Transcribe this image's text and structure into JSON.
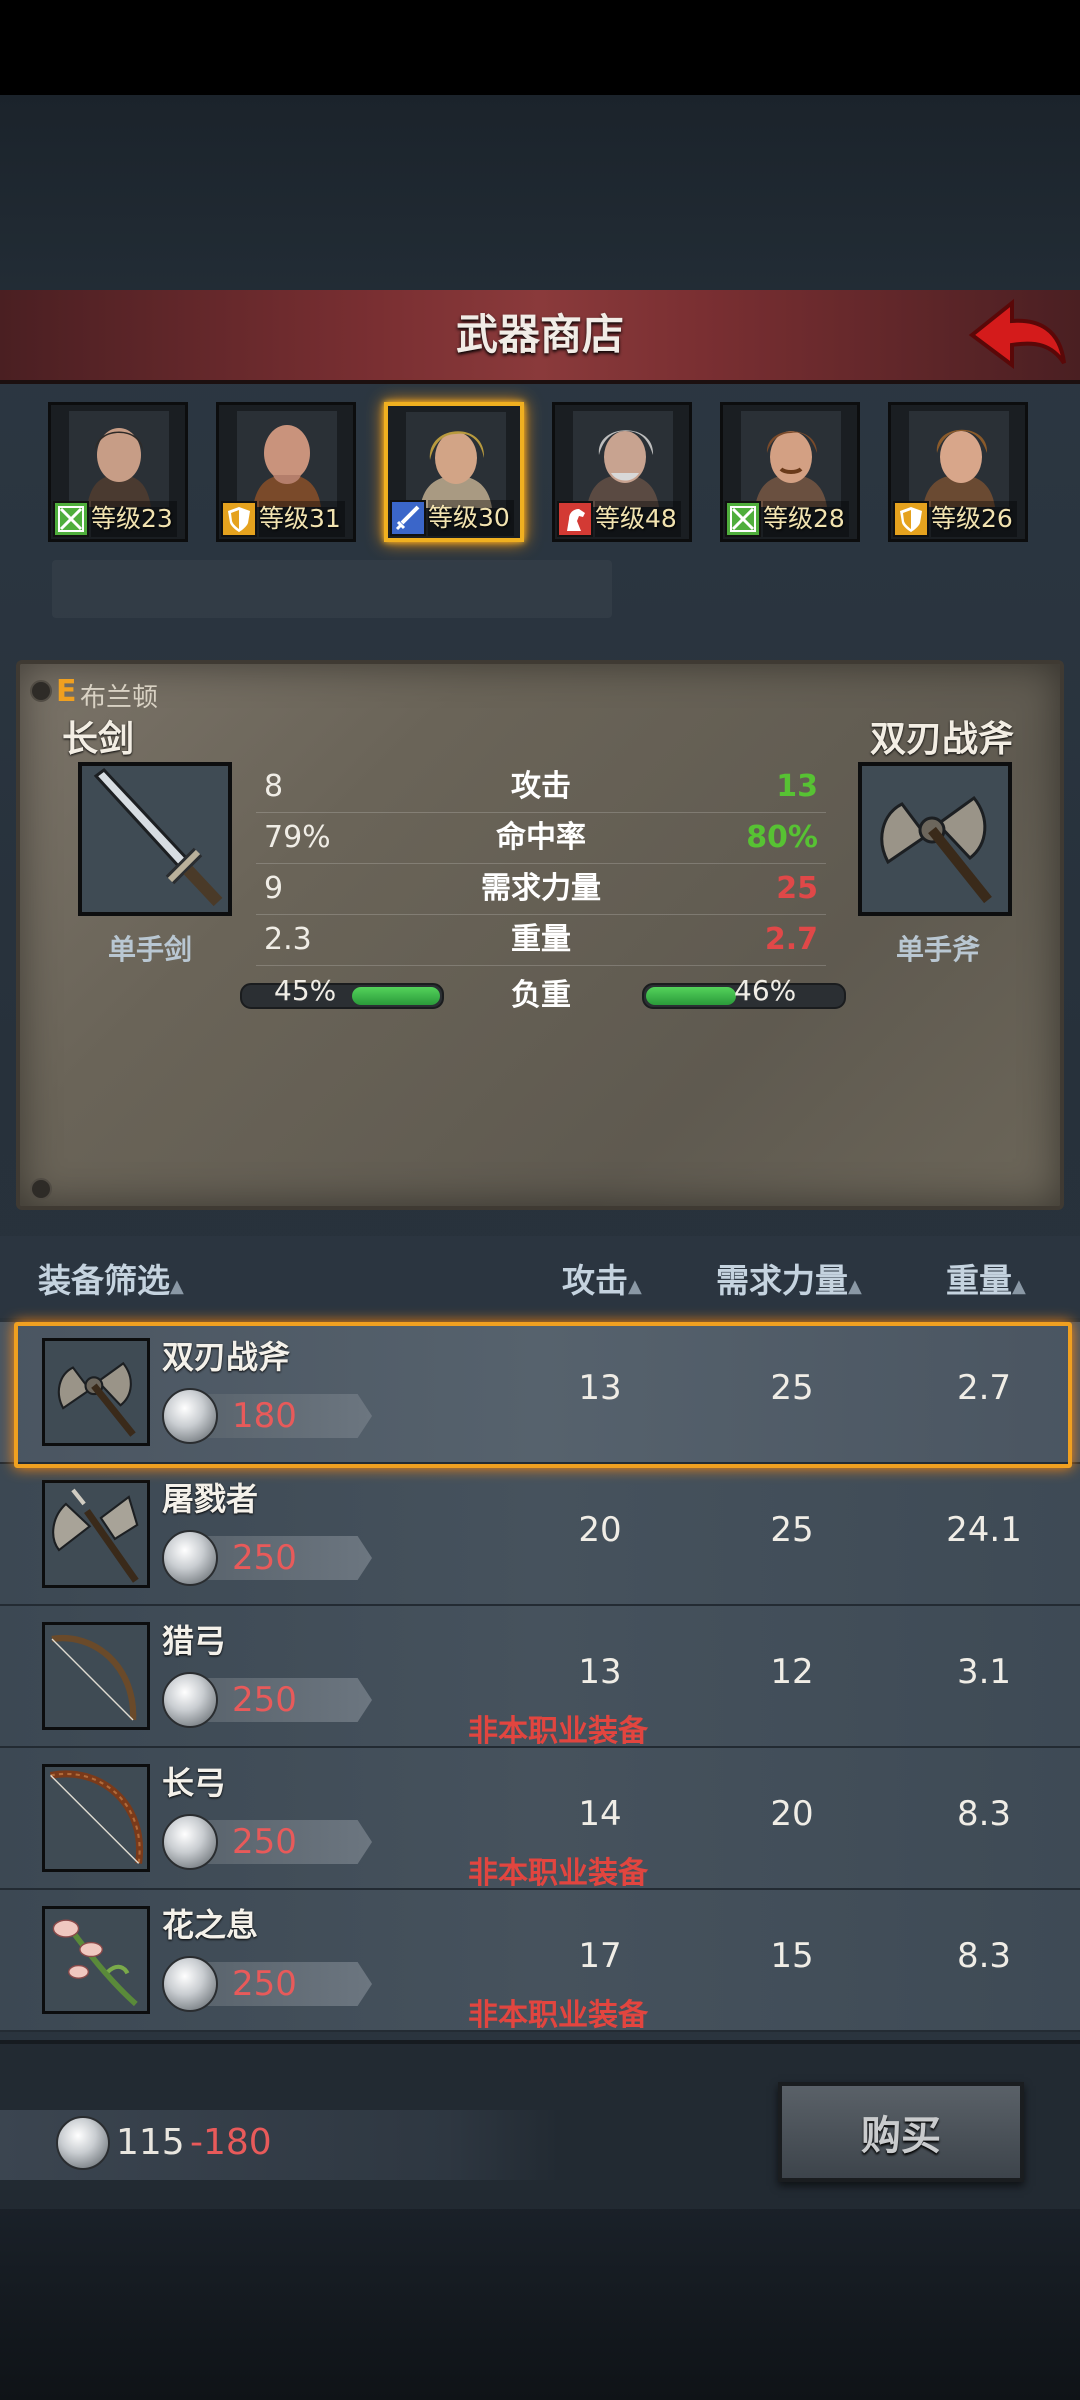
{
  "header": {
    "title": "武器商店"
  },
  "heroes": [
    {
      "class_icon": "bow-class-icon",
      "class_color": "#4fae3c",
      "level": "等级23",
      "hair": "#2e2a27",
      "skin": "#c79d86"
    },
    {
      "class_icon": "shield-class-icon",
      "class_color": "#e5a21e",
      "level": "等级31",
      "hair": "#b47e6b",
      "skin": "#c9937c"
    },
    {
      "class_icon": "sword-class-icon",
      "class_color": "#3b66c9",
      "level": "等级30",
      "hair": "#b89a3e",
      "skin": "#d2a486"
    },
    {
      "class_icon": "horse-class-icon",
      "class_color": "#d33a34",
      "level": "等级48",
      "hair": "#bdbdbd",
      "skin": "#c8a390"
    },
    {
      "class_icon": "bow-class-icon",
      "class_color": "#4fae3c",
      "level": "等级28",
      "hair": "#7a4a2a",
      "skin": "#d3a083"
    },
    {
      "class_icon": "shield-class-icon",
      "class_color": "#e5a21e",
      "level": "等级26",
      "hair": "#8a5a2a",
      "skin": "#d8a68a"
    }
  ],
  "compare": {
    "rank": "E",
    "hero_name": "布兰顿",
    "current": {
      "name": "长剑",
      "type": "单手剑",
      "icon": "sword-icon",
      "load": "45%",
      "load_fraction": 0.45
    },
    "candidate": {
      "name": "双刃战斧",
      "type": "单手斧",
      "icon": "double-axe-icon",
      "load": "46%",
      "load_fraction": 0.46
    },
    "stats": [
      {
        "label": "攻击",
        "current": "8",
        "new": "13",
        "trend": "up"
      },
      {
        "label": "命中率",
        "current": "79%",
        "new": "80%",
        "trend": "up"
      },
      {
        "label": "需求力量",
        "current": "9",
        "new": "25",
        "trend": "down"
      },
      {
        "label": "重量",
        "current": "2.3",
        "new": "2.7",
        "trend": "down"
      }
    ],
    "load_label": "负重"
  },
  "list_header": {
    "filter": "装备筛选",
    "attack": "攻击",
    "strength": "需求力量",
    "weight": "重量"
  },
  "items": [
    {
      "name": "双刃战斧",
      "price": "180",
      "attack": "13",
      "strength": "25",
      "weight": "2.7",
      "note": "",
      "icon": "double-axe-icon"
    },
    {
      "name": "屠戮者",
      "price": "250",
      "attack": "20",
      "strength": "25",
      "weight": "24.1",
      "note": "",
      "icon": "slaughter-axe-icon"
    },
    {
      "name": "猎弓",
      "price": "250",
      "attack": "13",
      "strength": "12",
      "weight": "3.1",
      "note": "非本职业装备",
      "icon": "hunting-bow-icon"
    },
    {
      "name": "长弓",
      "price": "250",
      "attack": "14",
      "strength": "20",
      "weight": "8.3",
      "note": "非本职业装备",
      "icon": "long-bow-icon"
    },
    {
      "name": "花之息",
      "price": "250",
      "attack": "17",
      "strength": "15",
      "weight": "8.3",
      "note": "非本职业装备",
      "icon": "flower-staff-icon"
    }
  ],
  "footer": {
    "money": "115",
    "cost": "-180",
    "buy_label": "购买"
  },
  "colors": {
    "accent": "#f0a020",
    "increase": "#57c233",
    "decrease": "#e04848",
    "price": "#e85a5a"
  }
}
